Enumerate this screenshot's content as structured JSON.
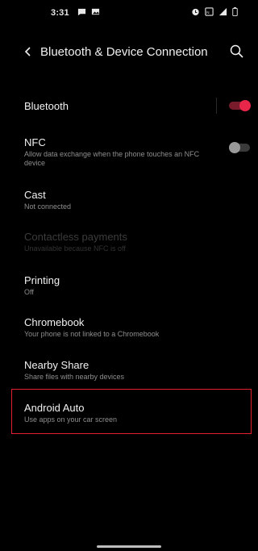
{
  "status_bar": {
    "time": "3:31",
    "icons_left": [
      "messaging-icon",
      "gallery-icon"
    ],
    "icons_right": [
      "alarm-icon",
      "nfc-icon",
      "signal-icon",
      "battery-icon"
    ]
  },
  "app_bar": {
    "title": "Bluetooth & Device Connection",
    "back_icon": "back-arrow-icon",
    "search_icon": "search-icon"
  },
  "colors": {
    "background": "#000000",
    "accent": "#e8264a",
    "highlight_border": "#e0202c"
  },
  "items": [
    {
      "title": "Bluetooth",
      "subtitle": "",
      "toggle": true,
      "toggle_on": true
    },
    {
      "title": "NFC",
      "subtitle": "Allow data exchange when the phone touches an NFC device",
      "toggle": true,
      "toggle_on": false
    },
    {
      "title": "Cast",
      "subtitle": "Not connected"
    },
    {
      "title": "Contactless payments",
      "subtitle": "Unavailable because NFC is off",
      "disabled": true
    },
    {
      "title": "Printing",
      "subtitle": "Off"
    },
    {
      "title": "Chromebook",
      "subtitle": "Your phone is not linked to a Chromebook"
    },
    {
      "title": "Nearby Share",
      "subtitle": "Share files with nearby devices"
    },
    {
      "title": "Android Auto",
      "subtitle": "Use apps on your car screen",
      "highlighted": true
    }
  ]
}
